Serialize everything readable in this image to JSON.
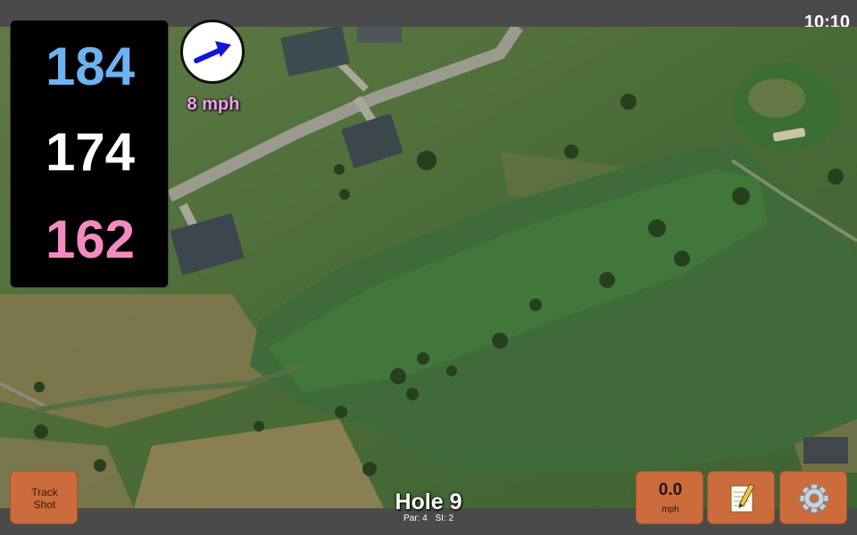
{
  "status_bar": {
    "time": "10:10"
  },
  "distances": {
    "back": "184",
    "middle": "174",
    "front": "162",
    "back_color": "#6db3f2",
    "middle_color": "#ffffff",
    "front_color": "#f58ac2"
  },
  "wind": {
    "speed_label": "8 mph",
    "label_color": "#f49df0",
    "arrow_color": "#1414d8",
    "icon": "wind-direction-arrow-icon"
  },
  "buttons": {
    "track_shot": "Track\nShot",
    "speed_value": "0.0",
    "speed_unit": "mph",
    "notes_icon": "notepad-icon",
    "settings_icon": "gear-icon",
    "accent_color": "#cc6b3c"
  },
  "hole": {
    "title": "Hole 9",
    "par": "Par: 4",
    "stroke_index": "SI: 2"
  }
}
